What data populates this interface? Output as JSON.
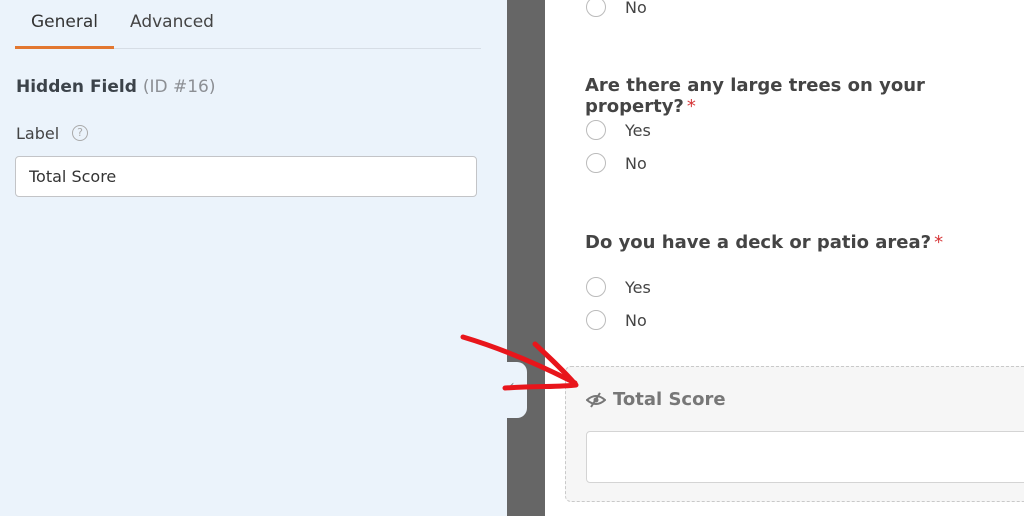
{
  "settings": {
    "tabs": [
      {
        "label": "General",
        "active": true
      },
      {
        "label": "Advanced",
        "active": false
      }
    ],
    "field_type": "Hidden Field",
    "field_id": "(ID #16)",
    "label_caption": "Label",
    "label_value": "Total Score"
  },
  "form": {
    "questions": [
      {
        "options": [
          "No"
        ]
      },
      {
        "text": "Are there any large trees on your property?",
        "required": "*",
        "options": [
          "Yes",
          "No"
        ]
      },
      {
        "text": "Do you have a deck or patio area?",
        "required": "*",
        "options": [
          "Yes",
          "No"
        ]
      }
    ],
    "hidden_field": {
      "label": "Total Score",
      "icon": "eye-slash-icon"
    }
  },
  "colors": {
    "accent": "#e27730",
    "annotation": "#e8151b",
    "required": "#d63638"
  }
}
